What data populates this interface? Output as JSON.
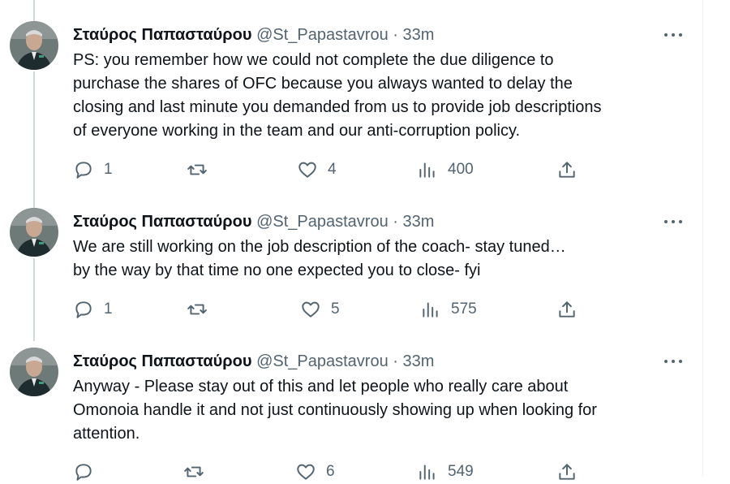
{
  "tweets": [
    {
      "display_name": "Σταύρος Παπασταύρου",
      "handle": "@St_Papastavrou",
      "separator": "·",
      "time": "33m",
      "lines": [
        "PS: you remember how we could not complete the due diligence to",
        "purchase the shares of OFC because you always wanted to delay the",
        "closing and last minute you demanded from us to provide job descriptions",
        "of everyone working in the team and our anti-corruption policy."
      ],
      "replies": "1",
      "retweets": "",
      "likes": "4",
      "views": "400"
    },
    {
      "display_name": "Σταύρος Παπασταύρου",
      "handle": "@St_Papastavrou",
      "separator": "·",
      "time": "33m",
      "lines": [
        "We are still working on the job description of the coach- stay tuned…",
        "by the way by that time no one expected you to close- fyi"
      ],
      "replies": "1",
      "retweets": "",
      "likes": "5",
      "views": "575"
    },
    {
      "display_name": "Σταύρος Παπασταύρου",
      "handle": "@St_Papastavrou",
      "separator": "·",
      "time": "33m",
      "lines": [
        "Anyway - Please stay out of this and let people who really care about",
        "Omonoia handle it and not just continuously showing up when looking for",
        "attention."
      ],
      "replies": "",
      "retweets": "",
      "likes": "6",
      "views": "549"
    }
  ],
  "icons": {
    "more": "more-horizontal-icon",
    "reply": "reply-icon",
    "retweet": "retweet-icon",
    "like": "heart-icon",
    "views": "views-bar-chart-icon",
    "share": "share-upload-icon"
  },
  "colors": {
    "text": "#0f1419",
    "secondary": "#536471",
    "thread_line": "#cfd9de"
  }
}
